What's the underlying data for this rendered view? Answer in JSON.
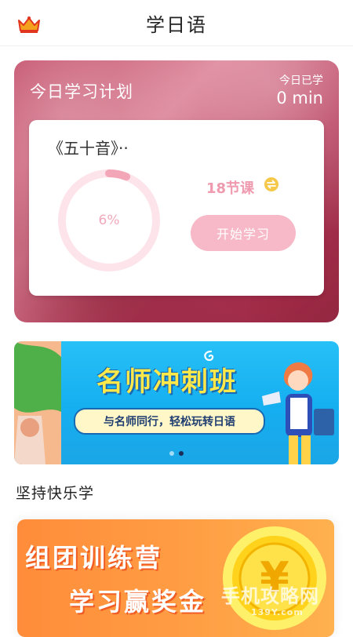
{
  "header": {
    "title": "学日语",
    "crown_icon": "crown-icon"
  },
  "plan": {
    "title": "今日学习计划",
    "today_label": "今日已学",
    "today_value": "0 min",
    "course": {
      "name": "《五十音》··",
      "progress": 0.06,
      "progress_text": "6%",
      "lessons": "18节课",
      "switch_icon": "switch-icon",
      "start_label": "开始学习"
    }
  },
  "banner": {
    "title": "名师冲刺班",
    "subtitle": "与名师同行，轻松玩转日语",
    "active_dot": 1,
    "dot_count": 2
  },
  "section": {
    "title": "坚持快乐学"
  },
  "promo": {
    "line1": "组团训练营",
    "line2": "学习赢奖金",
    "coin_symbol": "¥"
  },
  "watermark": {
    "text": "手机攻略网",
    "sub": "139Y.com"
  },
  "colors": {
    "accent_pink": "#ef9aae",
    "button_pink": "#f7b9c7",
    "banner_blue": "#1fb4f2",
    "promo_orange": "#ff9e44",
    "coin_gold": "#ffd21c"
  }
}
